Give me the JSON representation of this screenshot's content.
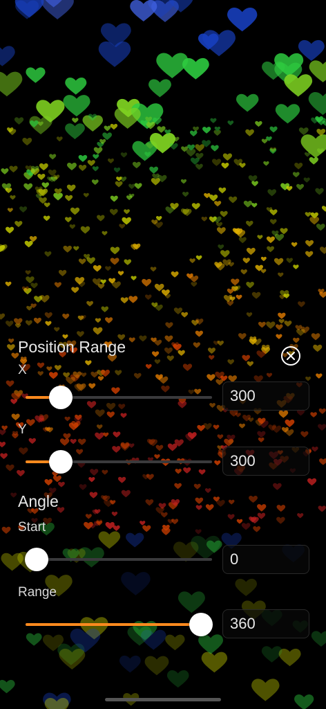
{
  "position_range": {
    "title": "Position Range",
    "x": {
      "label": "X",
      "value": "300",
      "fraction": 0.19
    },
    "y": {
      "label": "Y",
      "value": "300",
      "fraction": 0.19
    }
  },
  "angle": {
    "title": "Angle",
    "start": {
      "label": "Start",
      "value": "0",
      "fraction": 0.06
    },
    "range": {
      "label": "Range",
      "value": "360",
      "fraction": 0.94
    }
  },
  "colors": {
    "accent": "#ff8a1e",
    "heart_palette": [
      "#2ecc40",
      "#7fd321",
      "#c8d000",
      "#e0b000",
      "#e07a00",
      "#d44000",
      "#c42020",
      "#1840c0",
      "#4060e0"
    ]
  },
  "icons": {
    "close": "close-circle-icon"
  }
}
